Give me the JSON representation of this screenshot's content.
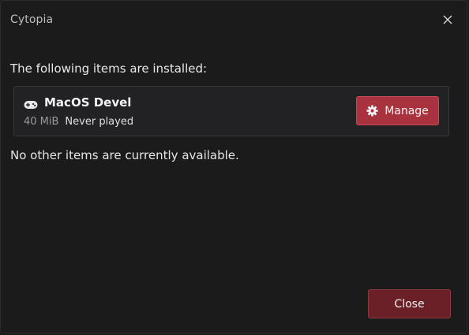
{
  "window": {
    "title": "Cytopia"
  },
  "main": {
    "installed_heading": "The following items are installed:",
    "items": [
      {
        "name": "MacOS Devel",
        "size": "40 MiB",
        "last_played": "Never played",
        "icon": "gamepad-icon",
        "action_label": "Manage",
        "action_icon": "gear-icon"
      }
    ],
    "no_other_text": "No other items are currently available."
  },
  "footer": {
    "close_label": "Close"
  },
  "colors": {
    "accent": "#a8333f",
    "close_button": "#6b1f26",
    "background": "#1b1b1c",
    "card": "#222224"
  }
}
